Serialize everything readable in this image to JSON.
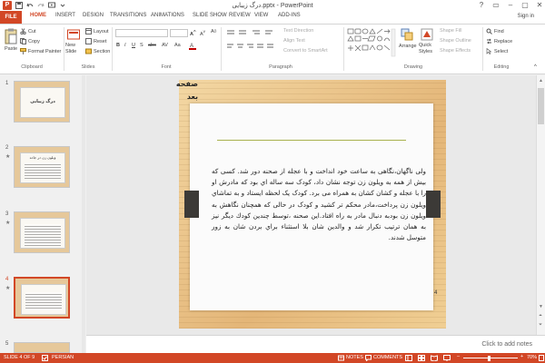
{
  "window": {
    "app_icon": "P",
    "title": "درگ زیبایی.pptx - PowerPoint",
    "controls": [
      "?",
      "▭",
      "–",
      "▢",
      "✕"
    ],
    "sign_in": "Sign in"
  },
  "tabs": [
    "FILE",
    "HOME",
    "INSERT",
    "DESIGN",
    "TRANSITIONS",
    "ANIMATIONS",
    "SLIDE SHOW",
    "REVIEW",
    "VIEW",
    "ADD-INS"
  ],
  "ribbon": {
    "clipboard": {
      "paste": "Paste",
      "cut": "Cut",
      "copy": "Copy",
      "format_painter": "Format Painter",
      "label": "Clipboard"
    },
    "slides": {
      "new_slide": "New Slide",
      "layout": "Layout",
      "reset": "Reset",
      "section": "Section",
      "label": "Slides"
    },
    "font": {
      "label": "Font"
    },
    "paragraph": {
      "text_direction": "Text Direction",
      "align_text": "Align Text",
      "convert_smartart": "Convert to SmartArt",
      "label": "Paragraph"
    },
    "drawing": {
      "arrange": "Arrange",
      "quick_styles": "Quick Styles",
      "shape_fill": "Shape Fill",
      "shape_outline": "Shape Outline",
      "shape_effects": "Shape Effects",
      "label": "Drawing"
    },
    "editing": {
      "find": "Find",
      "replace": "Replace",
      "select": "Select",
      "label": "Editing"
    }
  },
  "thumbnails": [
    {
      "num": "1",
      "title": "درگ زیبایی"
    },
    {
      "num": "2",
      "title": "ویلون زن در جاده"
    },
    {
      "num": "3",
      "title": ""
    },
    {
      "num": "4",
      "title": ""
    },
    {
      "num": "5",
      "title": ""
    }
  ],
  "slide": {
    "corner_text": "صفحه بعد",
    "body": "ولی ناگهان،نگاهی به ساعت خود انداخت و با عجله از صحنه دور شد. کسی که بیش از همه به ویلون زن توجه نشان داد، کودک سه ساله اي بود که مادرش او را با عجله و کشان کشان به همراه می برد. کودک یک لحظه ایستاد و به تماشاي ویلون زن پرداخت،مادر محکم تر کشید و کودک در حالی که همچنان نگاهش به ویلون زن بودبه دنبال مادر به راه افتاد.این صحنه ،توسط چندین کودك دیگر نیز به همان ترتیب تکرار شد و والدین شان بلا استثناء براي بردن شان به زور متوسل شدند.",
    "number": "4"
  },
  "notes_placeholder": "Click to add notes",
  "status": {
    "slide_info": "SLIDE 4 OF 9",
    "language": "PERSIAN",
    "notes": "NOTES",
    "comments": "COMMENTS",
    "zoom": "70%"
  }
}
